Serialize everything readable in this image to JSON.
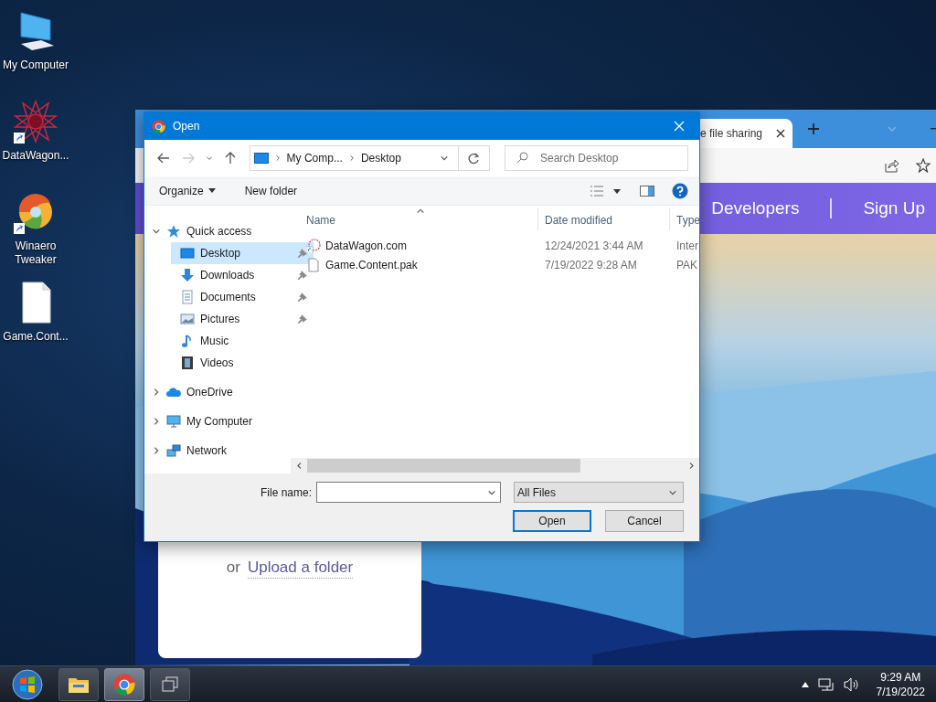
{
  "desktop_icons": [
    {
      "label": "My Computer",
      "kind": "computer",
      "shortcut": false
    },
    {
      "label": "DataWagon...",
      "kind": "star",
      "shortcut": true
    },
    {
      "label": "Winaero Tweaker",
      "kind": "swirl",
      "shortcut": true
    },
    {
      "label": "Game.Cont...",
      "kind": "file",
      "shortcut": false
    }
  ],
  "browser": {
    "tab": {
      "title": "e file sharing"
    },
    "nav_links": [
      "Developers",
      "Sign Up"
    ],
    "upload": {
      "prefix": "or",
      "link": "Upload a folder"
    }
  },
  "dialog": {
    "title": "Open",
    "breadcrumb": [
      "My Comp...",
      "Desktop"
    ],
    "search": {
      "placeholder": "Search Desktop"
    },
    "toolbar": [
      {
        "label": "Organize",
        "dropdown": true
      },
      {
        "label": "New folder",
        "dropdown": false
      }
    ],
    "nav": [
      {
        "label": "Quick access",
        "kind": "star",
        "expanded": true,
        "selected": false,
        "children": [
          {
            "label": "Desktop",
            "kind": "desktop",
            "selected": true,
            "pinned": true
          },
          {
            "label": "Downloads",
            "kind": "download",
            "selected": false,
            "pinned": true
          },
          {
            "label": "Documents",
            "kind": "document",
            "selected": false,
            "pinned": true
          },
          {
            "label": "Pictures",
            "kind": "picture",
            "selected": false,
            "pinned": true
          },
          {
            "label": "Music",
            "kind": "music",
            "selected": false,
            "pinned": false
          },
          {
            "label": "Videos",
            "kind": "video",
            "selected": false,
            "pinned": false
          }
        ]
      },
      {
        "label": "OneDrive",
        "kind": "cloud",
        "expanded": false,
        "selected": false
      },
      {
        "label": "My Computer",
        "kind": "computer",
        "expanded": false,
        "selected": false
      },
      {
        "label": "Network",
        "kind": "network",
        "expanded": false,
        "selected": false
      }
    ],
    "columns": [
      "Name",
      "Date modified",
      "Type"
    ],
    "files": [
      {
        "name": "DataWagon.com",
        "date": "12/24/2021 3:44 AM",
        "type": "Inter",
        "kind": "shortcut"
      },
      {
        "name": "Game.Content.pak",
        "date": "7/19/2022 9:28 AM",
        "type": "PAK",
        "kind": "file"
      }
    ],
    "file_name": {
      "label": "File name:"
    },
    "file_type": "All Files",
    "buttons": [
      {
        "label": "Open",
        "default": true
      },
      {
        "label": "Cancel",
        "default": false
      }
    ]
  },
  "taskbar": {
    "apps": [
      {
        "kind": "explorer",
        "selected": false
      },
      {
        "kind": "chrome",
        "selected": true
      },
      {
        "kind": "taskview",
        "selected": false
      }
    ],
    "time": "9:29 AM",
    "date": "7/19/2022"
  }
}
